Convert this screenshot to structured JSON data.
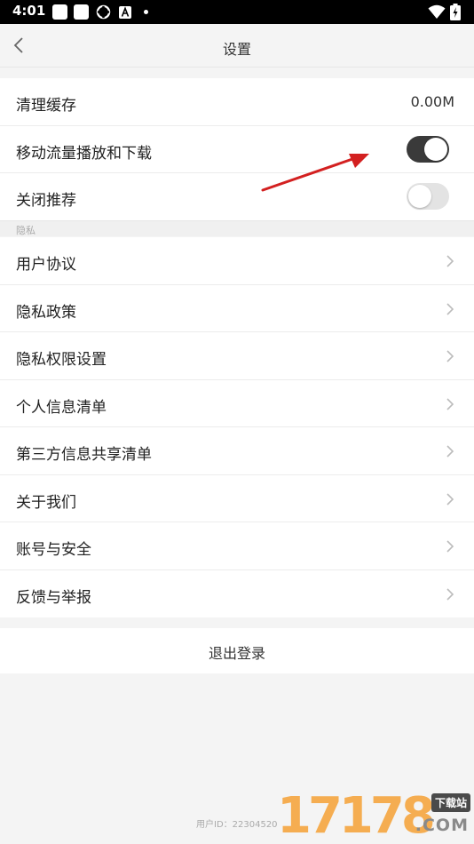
{
  "status_bar": {
    "time": "4:01"
  },
  "header": {
    "title": "设置"
  },
  "general": {
    "clear_cache": {
      "label": "清理缓存",
      "value": "0.00M"
    },
    "mobile_data": {
      "label": "移动流量播放和下载",
      "enabled": true
    },
    "close_recommend": {
      "label": "关闭推荐",
      "enabled": false
    }
  },
  "privacy": {
    "heading": "隐私",
    "items": [
      {
        "label": "用户协议"
      },
      {
        "label": "隐私政策"
      },
      {
        "label": "隐私权限设置"
      },
      {
        "label": "个人信息清单"
      },
      {
        "label": "第三方信息共享清单"
      },
      {
        "label": "关于我们"
      },
      {
        "label": "账号与安全"
      },
      {
        "label": "反馈与举报"
      }
    ]
  },
  "logout": {
    "label": "退出登录"
  },
  "footer": {
    "user_id": "用户ID：22304520"
  },
  "watermark": {
    "digits": "17178",
    "badge": "下载站",
    "domain": ".COM"
  },
  "colors": {
    "toggle_on": "#3a3a3a",
    "toggle_off": "#e3e3e3",
    "annotation_arrow": "#d32020",
    "watermark": "#f6a640"
  }
}
